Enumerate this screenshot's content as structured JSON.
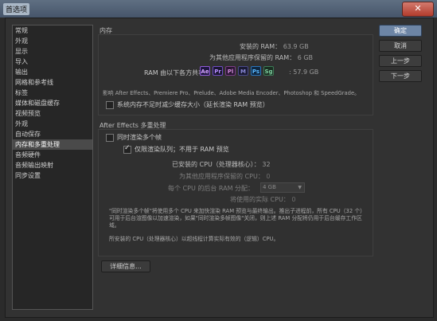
{
  "window": {
    "title": "首选项",
    "close_glyph": "✕"
  },
  "sidebar": {
    "items": [
      {
        "label": "常规"
      },
      {
        "label": "外观"
      },
      {
        "label": "显示"
      },
      {
        "label": "导入"
      },
      {
        "label": "输出"
      },
      {
        "label": "网格和参考线"
      },
      {
        "label": "标签"
      },
      {
        "label": "媒体和磁盘缓存"
      },
      {
        "label": "视频预览"
      },
      {
        "label": "外观"
      },
      {
        "label": "自动保存"
      },
      {
        "label": "内存和多重处理"
      },
      {
        "label": "音频硬件"
      },
      {
        "label": "音频输出映射"
      },
      {
        "label": "同步设置"
      }
    ],
    "selected_index": 11
  },
  "memory": {
    "title": "内存",
    "installed_label": "安装的 RAM：",
    "installed_value": "63.9 GB",
    "reserved_label": "为其他应用程序保留的 RAM：",
    "reserved_value": "6 GB",
    "shared_label": "RAM 由以下各方共享",
    "shared_value": "57.9 GB",
    "apps": [
      {
        "abbr": "Ae",
        "bg": "#1f1740",
        "fg": "#d4a3ff",
        "border": "#8f5ad8"
      },
      {
        "abbr": "Pr",
        "bg": "#1a1630",
        "fg": "#b58bff",
        "border": "#6e4ac2"
      },
      {
        "abbr": "Pl",
        "bg": "#2a1633",
        "fg": "#d08ad8",
        "border": "#7a3d85"
      },
      {
        "abbr": "M",
        "bg": "#1a1a33",
        "fg": "#8a8ad8",
        "border": "#4a4a8a"
      },
      {
        "abbr": "Ps",
        "bg": "#0f2740",
        "fg": "#59b8ff",
        "border": "#2a73b8"
      },
      {
        "abbr": "Sg",
        "bg": "#1a2e22",
        "fg": "#7ed0a0",
        "border": "#3c7a55"
      }
    ],
    "impact_note": "影响 After Effects、Premiere Pro、Prelude、Adobe Media Encoder、Photoshop 和 SpeedGrade。",
    "reduce_cache_label": "系统内存不足时减少缓存大小（延长渲染 RAM 预览）"
  },
  "multiprocessing": {
    "title": "After Effects 多重处理",
    "render_multiple_label": "同时渲染多个帧",
    "render_queue_label": "仅限渲染队列；不用于 RAM 预览",
    "installed_cpu_label": "已安装的 CPU（处理器核心）：",
    "installed_cpu_value": "32",
    "reserved_cpu_label": "为其他应用程序保留的 CPU：",
    "reserved_cpu_value": "0",
    "ram_per_cpu_label": "每个 CPU 的后台 RAM 分配：",
    "ram_per_cpu_value": "4 GB",
    "actual_cpu_label": "将使用的实际 CPU：",
    "actual_cpu_value": "0",
    "note1": "\"同时渲染多个帧\"将使用多个 CPU 来加快渲染 RAM 预览与最终输出。推出子进程前，所有 CPU（32 个）可用于后台渲图像以加速渲染，如果\"同时渲染多帧图像\"关闭，则上述 RAM 分配将仍用于后台缓存工作区域。",
    "note2": "所安装的 CPU（处理器核心）以超线程计算实际有效的（逻辑）CPU。"
  },
  "buttons": {
    "ok": "确定",
    "cancel": "取消",
    "prev": "上一步",
    "next": "下一步",
    "details": "详细信息..."
  }
}
